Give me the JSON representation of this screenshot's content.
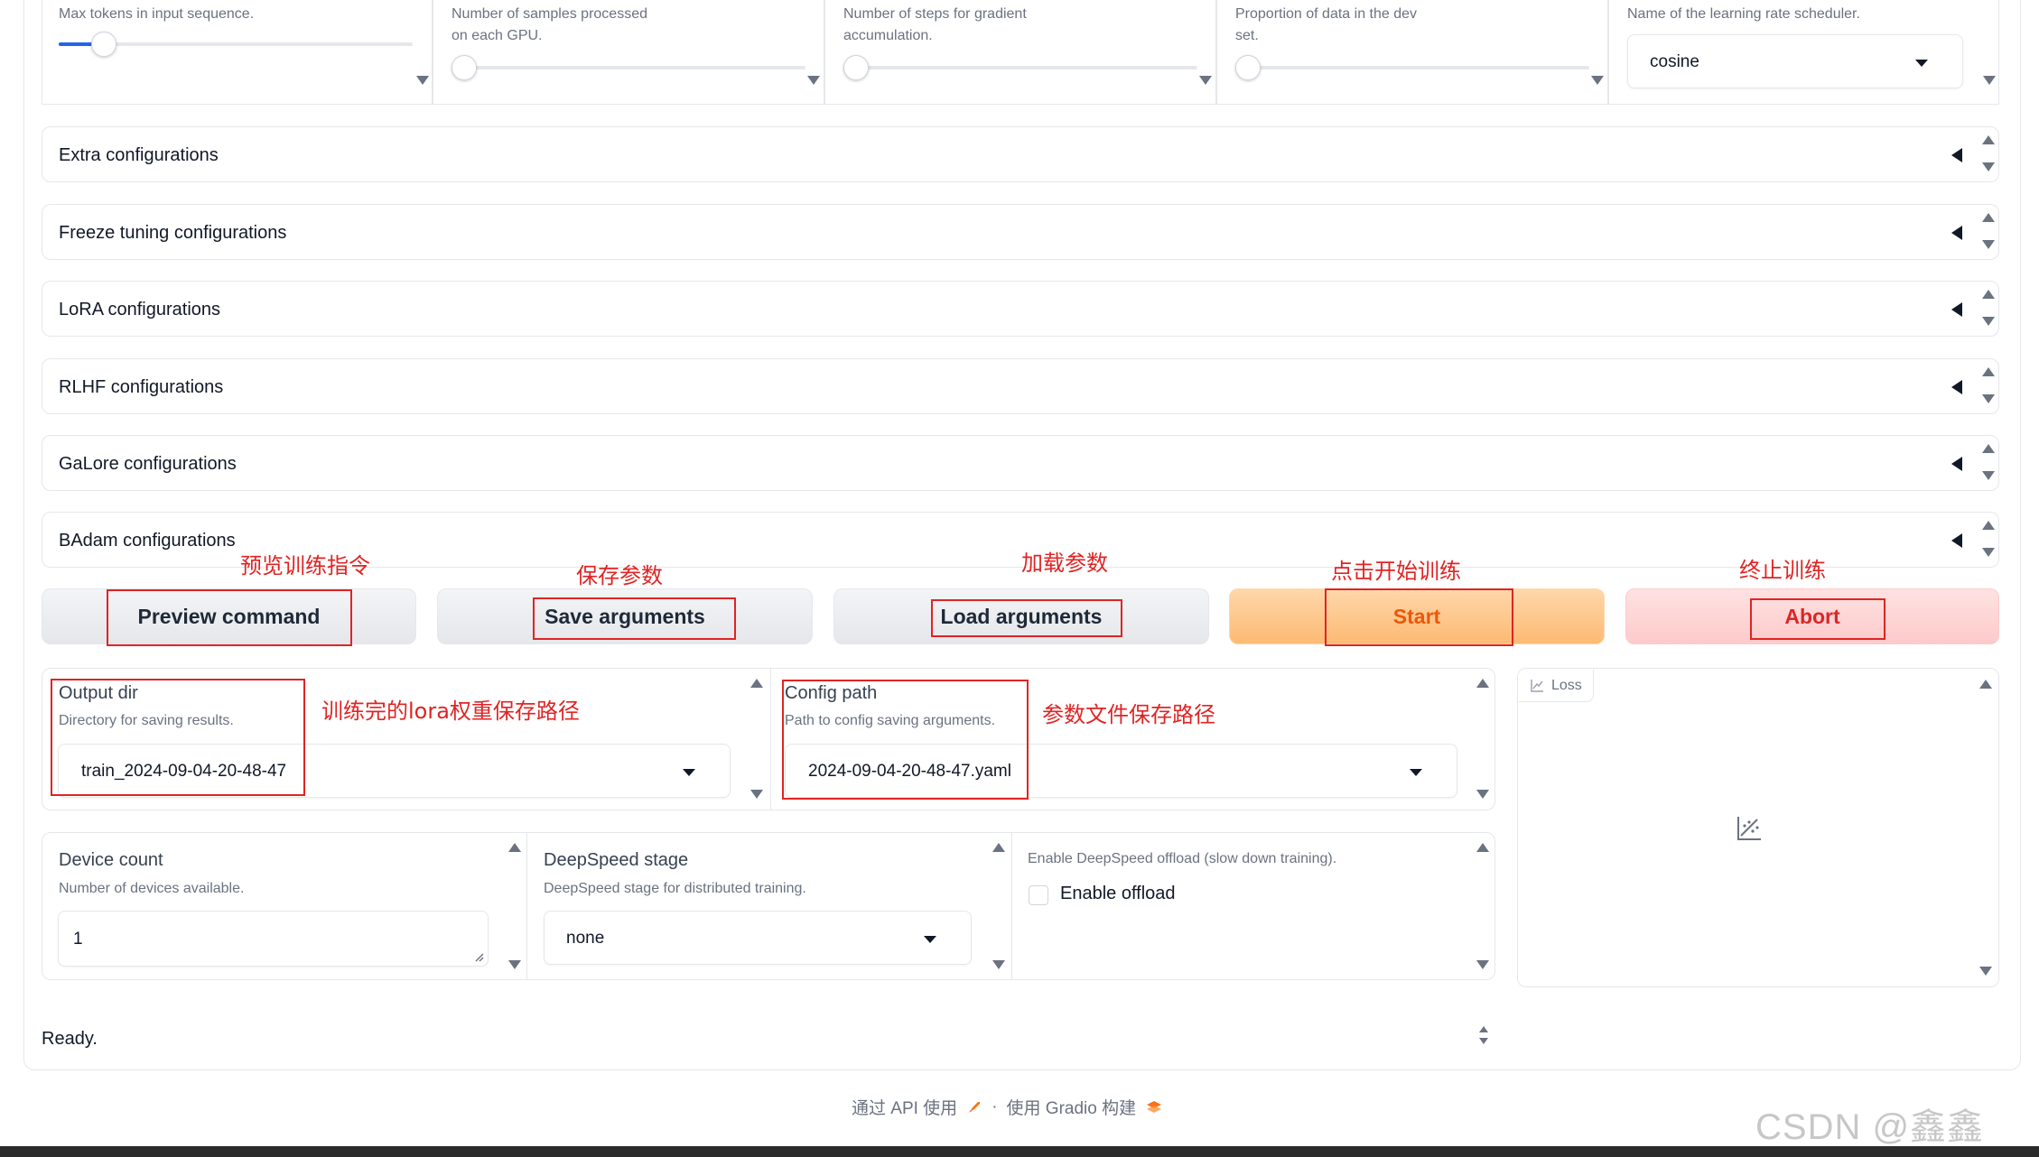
{
  "top_row": {
    "cutoff_info": "Max tokens in input sequence.",
    "batch_info_1": "Number of samples processed",
    "batch_info_2": "on each GPU.",
    "grad_info_1": "Number of steps for gradient",
    "grad_info_2": "accumulation.",
    "val_info_1": "Proportion of data in the dev",
    "val_info_2": "set.",
    "scheduler_info": "Name of the learning rate scheduler.",
    "scheduler_value": "cosine"
  },
  "accordions": [
    {
      "label": "Extra configurations"
    },
    {
      "label": "Freeze tuning configurations"
    },
    {
      "label": "LoRA configurations"
    },
    {
      "label": "RLHF configurations"
    },
    {
      "label": "GaLore configurations"
    },
    {
      "label": "BAdam configurations"
    }
  ],
  "buttons": {
    "preview": "Preview command",
    "save": "Save arguments",
    "load": "Load arguments",
    "start": "Start",
    "abort": "Abort"
  },
  "annotations": {
    "preview": "预览训练指令",
    "save": "保存参数",
    "load": "加载参数",
    "start": "点击开始训练",
    "abort": "终止训练",
    "output_dir": "训练完的lora权重保存路径",
    "config_path": "参数文件保存路径"
  },
  "output_dir": {
    "label": "Output dir",
    "info": "Directory for saving results.",
    "value": "train_2024-09-04-20-48-47"
  },
  "config_path": {
    "label": "Config path",
    "info": "Path to config saving arguments.",
    "value": "2024-09-04-20-48-47.yaml"
  },
  "loss_plot": {
    "label": "Loss"
  },
  "device_count": {
    "label": "Device count",
    "info": "Number of devices available.",
    "value": "1"
  },
  "deepspeed_stage": {
    "label": "DeepSpeed stage",
    "info": "DeepSpeed stage for distributed training.",
    "value": "none"
  },
  "deepspeed_offload": {
    "info": "Enable DeepSpeed offload (slow down training).",
    "label": "Enable offload"
  },
  "status": {
    "text": "Ready."
  },
  "footer": {
    "api_text": "通过 API 使用",
    "separator": "·",
    "gradio_text": "使用 Gradio 构建"
  },
  "watermark": "CSDN @鑫鑫"
}
